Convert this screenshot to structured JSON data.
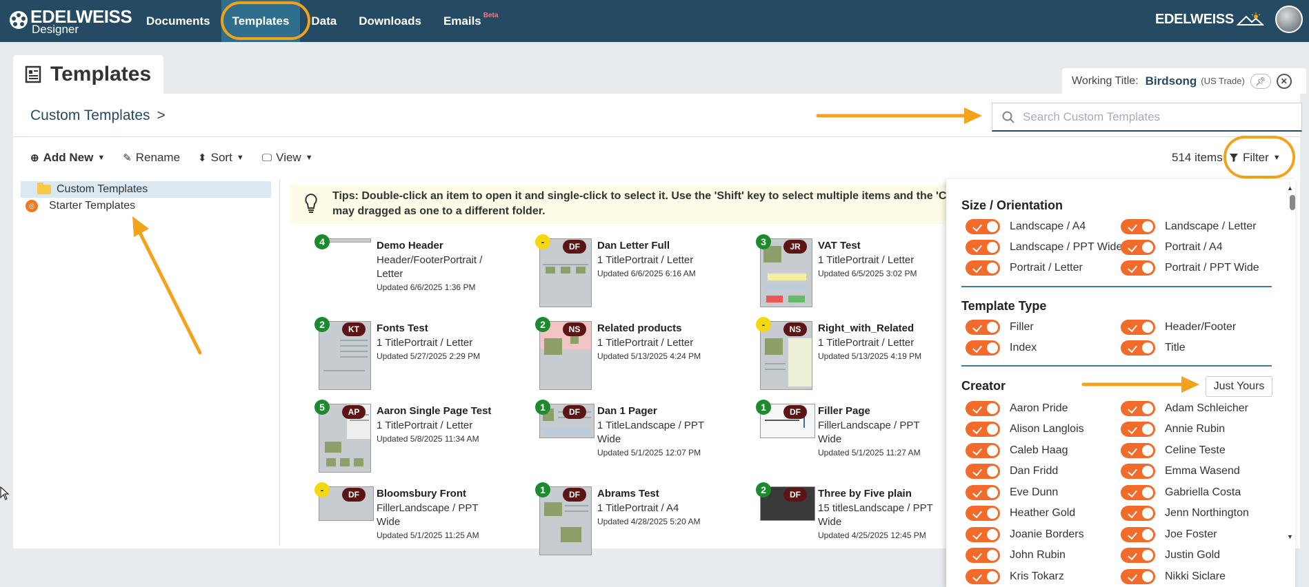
{
  "nav": {
    "brand_name": "EDELWEISS",
    "brand_sub": "Designer",
    "items": [
      {
        "label": "Documents"
      },
      {
        "label": "Templates",
        "active": true
      },
      {
        "label": "Data"
      },
      {
        "label": "Downloads"
      },
      {
        "label": "Emails",
        "badge": "Beta"
      }
    ],
    "brand_right": "EDELWEISS"
  },
  "page": {
    "title": "Templates",
    "working_title_label": "Working Title:",
    "working_title_value": "Birdsong",
    "working_title_sub": "(US Trade)"
  },
  "breadcrumb": {
    "current": "Custom Templates",
    "sep": ">"
  },
  "search": {
    "placeholder": "Search Custom Templates"
  },
  "toolbar": {
    "add_new": "Add New",
    "rename": "Rename",
    "sort": "Sort",
    "view": "View",
    "item_count": "514 items",
    "filter": "Filter"
  },
  "tree": [
    {
      "label": "Custom Templates",
      "selected": true
    },
    {
      "label": "Starter Templates"
    }
  ],
  "tips": {
    "line1": "Tips: Double-click an item to open it and single-click to select it. Use the 'Shift' key to select multiple items and the 'Ctrl",
    "line2": "may dragged as one to a different folder."
  },
  "cards": [
    {
      "title": "Demo Header",
      "sub": "Header/FooterPortrait / Letter",
      "updated": "Updated 6/6/2025 1:36 PM",
      "count": "4",
      "initials": ""
    },
    {
      "title": "Dan Letter Full",
      "sub": "1 TitlePortrait / Letter",
      "updated": "Updated 6/6/2025 6:16 AM",
      "count": "-",
      "initials": "DF"
    },
    {
      "title": "VAT Test",
      "sub": "1 TitlePortrait / Letter",
      "updated": "Updated 6/5/2025 3:02 PM",
      "count": "3",
      "initials": "JR"
    },
    {
      "title": "Fonts Test",
      "sub": "1 TitlePortrait / Letter",
      "updated": "Updated 5/27/2025 2:29 PM",
      "count": "2",
      "initials": "KT"
    },
    {
      "title": "Related products",
      "sub": "1 TitlePortrait / Letter",
      "updated": "Updated 5/13/2025 4:24 PM",
      "count": "2",
      "initials": "NS"
    },
    {
      "title": "Right_with_Related",
      "sub": "1 TitlePortrait / Letter",
      "updated": "Updated 5/13/2025 4:19 PM",
      "count": "-",
      "initials": "NS"
    },
    {
      "title": "Aaron Single Page Test",
      "sub": "1 TitlePortrait / Letter",
      "updated": "Updated 5/8/2025 11:34 AM",
      "count": "5",
      "initials": "AP"
    },
    {
      "title": "Dan 1 Pager",
      "sub": "1 TitleLandscape / PPT Wide",
      "updated": "Updated 5/1/2025 12:07 PM",
      "count": "1",
      "initials": "DF"
    },
    {
      "title": "Filler Page",
      "sub": "FillerLandscape / PPT Wide",
      "updated": "Updated 5/1/2025 11:27 AM",
      "count": "1",
      "initials": "DF"
    },
    {
      "title": "Bloomsbury Front",
      "sub": "FillerLandscape / PPT Wide",
      "updated": "Updated 5/1/2025 11:25 AM",
      "count": "-",
      "initials": "DF"
    },
    {
      "title": "Abrams Test",
      "sub": "1 TitlePortrait / A4",
      "updated": "Updated 4/28/2025 5:20 AM",
      "count": "1",
      "initials": "DF"
    },
    {
      "title": "Three by Five plain",
      "sub": "15 titlesLandscape / PPT Wide",
      "updated": "Updated 4/25/2025 12:45 PM",
      "count": "2",
      "initials": "DF"
    }
  ],
  "filter_panel": {
    "size_title": "Size / Orientation",
    "size_options": [
      "Landscape / A4",
      "Landscape / Letter",
      "Landscape / PPT Wide",
      "Portrait / A4",
      "Portrait / Letter",
      "Portrait / PPT Wide"
    ],
    "type_title": "Template Type",
    "type_options": [
      "Filler",
      "Header/Footer",
      "Index",
      "Title"
    ],
    "creator_title": "Creator",
    "just_yours": "Just Yours",
    "creators": [
      "Aaron Pride",
      "Adam Schleicher",
      "Alison Langlois",
      "Annie Rubin",
      "Caleb Haag",
      "Celine Teste",
      "Dan Fridd",
      "Emma Wasend",
      "Eve Dunn",
      "Gabriella Costa",
      "Heather Gold",
      "Jenn Northington",
      "Joanie Borders",
      "Joe Foster",
      "John Rubin",
      "Justin Gold",
      "Kris Tokarz",
      "Nikki Siclare"
    ]
  },
  "colors": {
    "nav_bg": "#254a63",
    "nav_active": "#2f6e8d",
    "toggle_on": "#f26b2a",
    "highlight": "#f2a31b",
    "badge_green": "#1e8a2e",
    "badge_yellow": "#f5d80f",
    "badge_initials": "#5c1414"
  }
}
